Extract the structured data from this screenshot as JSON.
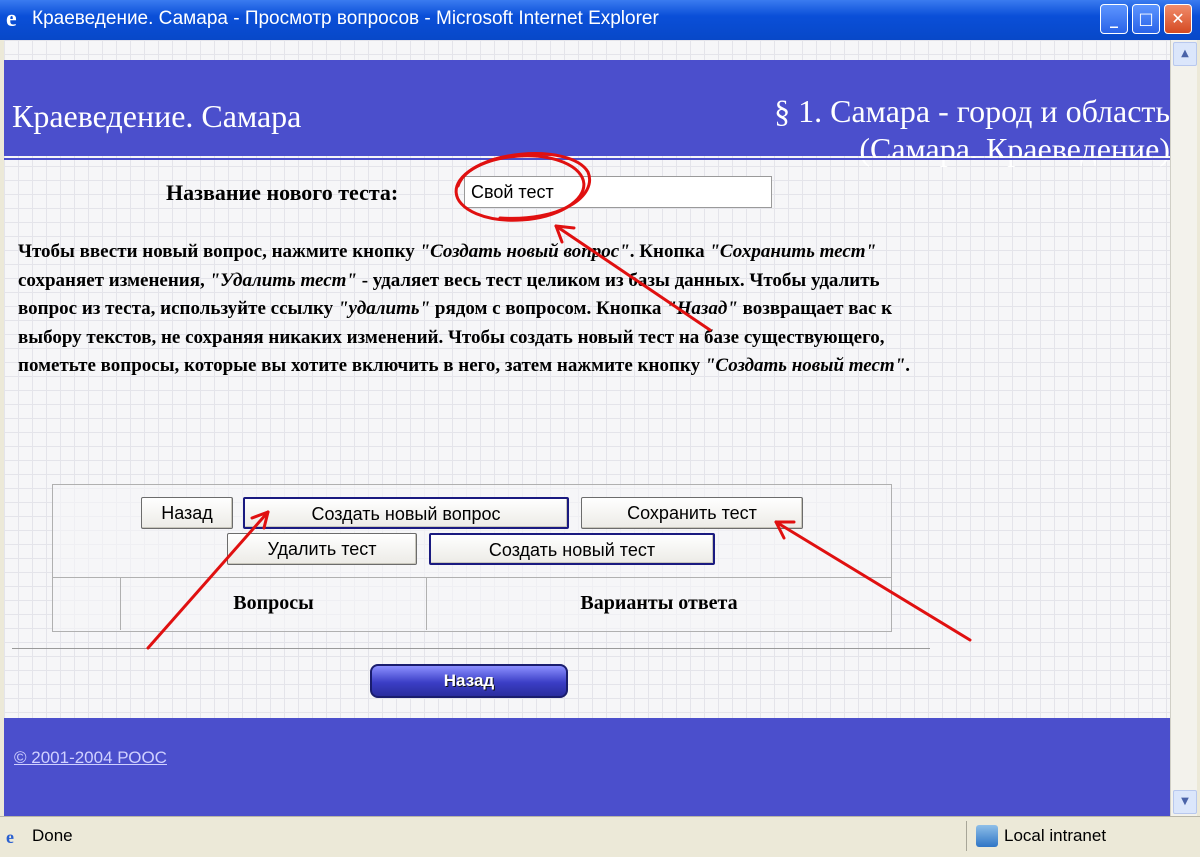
{
  "window": {
    "title": "Краеведение. Самара - Просмотр вопросов - Microsoft Internet Explorer",
    "icon": "ie-icon",
    "minimize_glyph": "_",
    "maximize_glyph": "□",
    "close_glyph": "✕"
  },
  "header": {
    "site_title": "Краеведение. Самара",
    "section_line1": "§ 1. Самара - город и область",
    "section_line2": "(Самара. Краеведение)"
  },
  "form": {
    "test_name_label": "Название нового теста:",
    "test_name_value": "Свой тест"
  },
  "instructions": {
    "p1": "Чтобы ввести новый вопрос, нажмите кнопку ",
    "p2": "\"Создать новый вопрос\"",
    "p3": ". Кнопка ",
    "p4": "\"Сохранить тест\"",
    "p5": " сохраняет изменения, ",
    "p6": "\"Удалить тест\"",
    "p7": " - удаляет весь тест целиком из базы данных. Чтобы удалить вопрос из теста, используйте ссылку ",
    "p8": "\"удалить\"",
    "p9": " рядом с вопросом. Кнопка ",
    "p10": "\"Назад\"",
    "p11": " возвращает вас к выбору текстов, не сохраняя никаких изменений. Чтобы создать новый тест на базе существующего, пометьте вопросы, которые вы хотите включить в него, затем нажмите кнопку ",
    "p12": "\"Создать новый тест\"",
    "p13": "."
  },
  "buttons": {
    "back": "Назад",
    "create_question": "Создать новый вопрос",
    "save_test": "Сохранить тест",
    "delete_test": "Удалить тест",
    "create_test": "Создать новый тест",
    "back_pill": "Назад"
  },
  "table": {
    "col_empty_1": "",
    "col_empty_2": "",
    "col_questions": "Вопросы",
    "col_answers": "Варианты ответа"
  },
  "footer": {
    "copyright": "© 2001-2004 РООС"
  },
  "statusbar": {
    "status": "Done",
    "zone": "Local intranet"
  },
  "colors": {
    "header_band": "#4b4fcc",
    "annotation_red": "#e01010"
  }
}
